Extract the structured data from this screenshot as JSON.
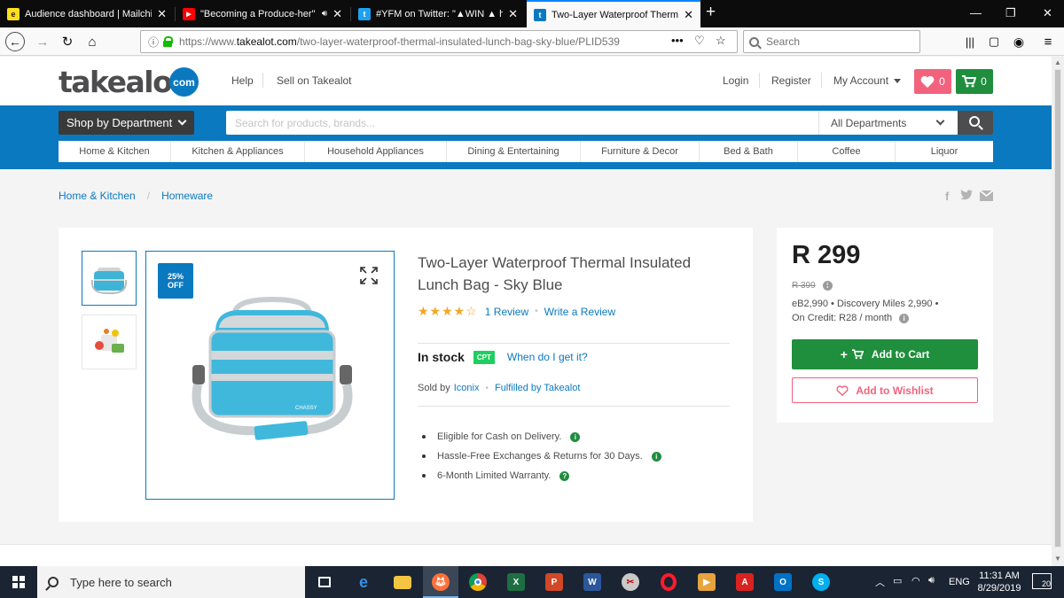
{
  "browser": {
    "tabs": [
      {
        "title": "Audience dashboard | Mailchim",
        "favicon_color": "#ffe01b",
        "favicon_glyph": "e",
        "extra": ""
      },
      {
        "title": "\"Becoming a Produce-her\"",
        "favicon_color": "#ff0000",
        "favicon_glyph": "▶",
        "extra": "speaker-icon"
      },
      {
        "title": "#YFM on Twitter: \"▲WIN ▲ h",
        "favicon_color": "#1da1f2",
        "favicon_glyph": "t",
        "extra": ""
      },
      {
        "title": "Two-Layer Waterproof Thermal",
        "favicon_color": "#0b79bf",
        "favicon_glyph": "t",
        "extra": ""
      }
    ],
    "url_prefix": "https://www.",
    "url_host": "takealot.com",
    "url_rest": "/two-layer-waterproof-thermal-insulated-lunch-bag-sky-blue/PLID539",
    "search_placeholder": "Search"
  },
  "header": {
    "logo": "takealot",
    "logo_com": "com",
    "help": "Help",
    "sell": "Sell on Takealot",
    "login": "Login",
    "register": "Register",
    "my_account": "My Account",
    "wishlist_count": "0",
    "cart_count": "0"
  },
  "nav": {
    "shop_by_department": "Shop by Department",
    "search_placeholder": "Search for products, brands...",
    "department_select": "All Departments",
    "categories": [
      "Home & Kitchen",
      "Kitchen & Appliances",
      "Household Appliances",
      "Dining & Entertaining",
      "Furniture & Decor",
      "Bed & Bath",
      "Coffee",
      "Liquor"
    ]
  },
  "breadcrumb": [
    "Home & Kitchen",
    "Homeware"
  ],
  "product": {
    "discount_line1": "25%",
    "discount_line2": "OFF",
    "title": "Two-Layer Waterproof Thermal Insulated Lunch Bag - Sky Blue",
    "rating": 4,
    "rating_max": 5,
    "reviews": "1 Review",
    "write_review": "Write a Review",
    "stock": "In stock",
    "warehouse": "CPT",
    "when_get": "When do I get it?",
    "sold_by_label": "Sold by",
    "seller": "Iconix",
    "fulfilled": "Fulfilled by Takealot",
    "features": [
      "Eligible for Cash on Delivery.",
      "Hassle-Free Exchanges & Returns for 30 Days.",
      "6-Month Limited Warranty."
    ],
    "brand_print": "CHASSY"
  },
  "buybox": {
    "price": "R 299",
    "old_price": "R 399",
    "miles": "eB2,990 • Discovery Miles 2,990 •",
    "credit": "On Credit: R28 / month",
    "add_to_cart": "Add to Cart",
    "add_to_wishlist": "Add to Wishlist"
  },
  "taskbar": {
    "search_placeholder": "Type here to search",
    "lang": "ENG",
    "time": "11:31 AM",
    "date": "8/29/2019",
    "notifications": "20"
  },
  "colors": {
    "brand_blue": "#0b79bf",
    "cart_green": "#1f8e3d",
    "wish_pink": "#f2627d",
    "star": "#f5a623"
  }
}
